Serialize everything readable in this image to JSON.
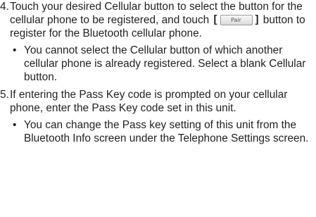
{
  "steps": [
    {
      "number": "4.",
      "text_before_button": "Touch your desired Cellular button to select the button for the cellular phone to be registered, and touch",
      "button_label": "Pair",
      "text_after_button": "button to register for the Bluetooth cellular phone.",
      "bullets": [
        "You cannot select the Cellular button of which another cellular phone is already registered. Select a blank Cellular button."
      ]
    },
    {
      "number": "5.",
      "text": "If entering the Pass Key code is prompted on your cellular phone, enter the Pass Key code set in this unit.",
      "bullets": [
        "You can change the Pass key setting of this unit from the Bluetooth Info screen under the Telephone Settings screen."
      ]
    }
  ],
  "bullet_symbol": "•"
}
